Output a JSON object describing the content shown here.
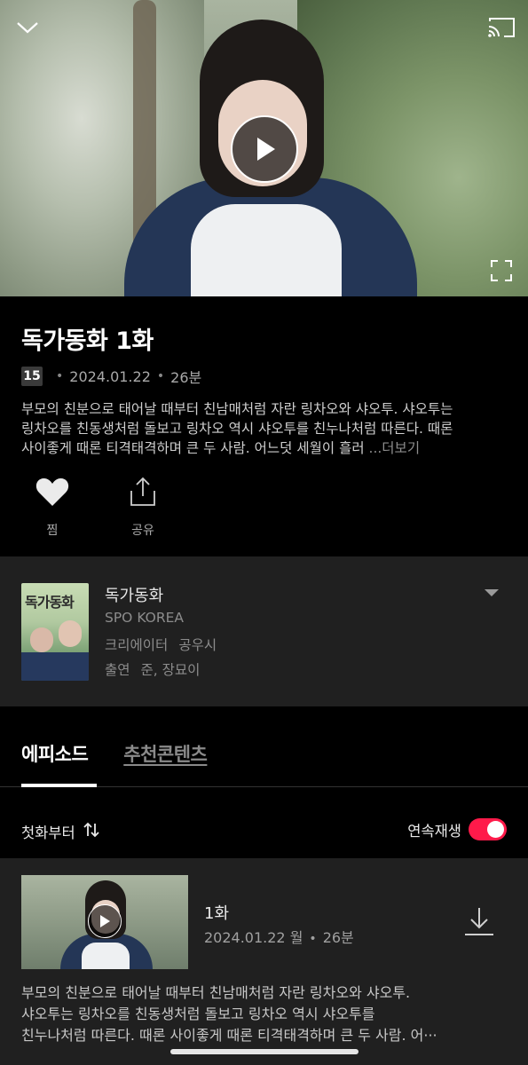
{
  "player": {
    "collapse_icon": "chevron-down-icon",
    "cast_icon": "cast-icon",
    "play_icon": "play-icon",
    "fullscreen_icon": "fullscreen-icon"
  },
  "episode_info": {
    "title": "독가동화 1화",
    "age_rating": "15",
    "date": "2024.01.22",
    "duration": "26분",
    "description_line1": "부모의 친분으로 태어날 때부터 친남매처럼 자란 링차오와 샤오투. 샤오투는",
    "description_line2": "링차오를 친동생처럼 돌보고 링차오 역시 샤오투를 친누나처럼 따른다. 때론",
    "description_line3": "사이좋게 때론 티격태격하며 큰 두 사람. 어느덧 세월이 흘러 ",
    "more_label": "...더보기"
  },
  "actions": [
    {
      "label": "찜",
      "icon": "heart-icon"
    },
    {
      "label": "공유",
      "icon": "share-icon"
    }
  ],
  "program": {
    "poster_title": "독가동화",
    "name": "독가동화",
    "studio": "SPO KOREA",
    "creator_label": "크리에이터",
    "creator": "공우시",
    "cast_label": "출연",
    "cast": "준, 장묘이"
  },
  "tabs": [
    {
      "label": "에피소드",
      "active": true
    },
    {
      "label": "추천콘텐츠",
      "active": false
    }
  ],
  "list_controls": {
    "sort_label": "첫화부터",
    "autoplay_label": "연속재생",
    "autoplay_on": true,
    "toggle_color": "#ff1a4a"
  },
  "episodes": [
    {
      "title": "1화",
      "date": "2024.01.22 월",
      "duration": "26분",
      "desc_line1": "부모의 친분으로 태어날 때부터 친남매처럼 자란 링차오와 샤오투.",
      "desc_line2": "샤오투는 링차오를 친동생처럼 돌보고 링차오 역시 샤오투를",
      "desc_line3": "친누나처럼 따른다. 때론 사이좋게 때론 티격태격하며 큰 두 사람. 어···"
    }
  ]
}
